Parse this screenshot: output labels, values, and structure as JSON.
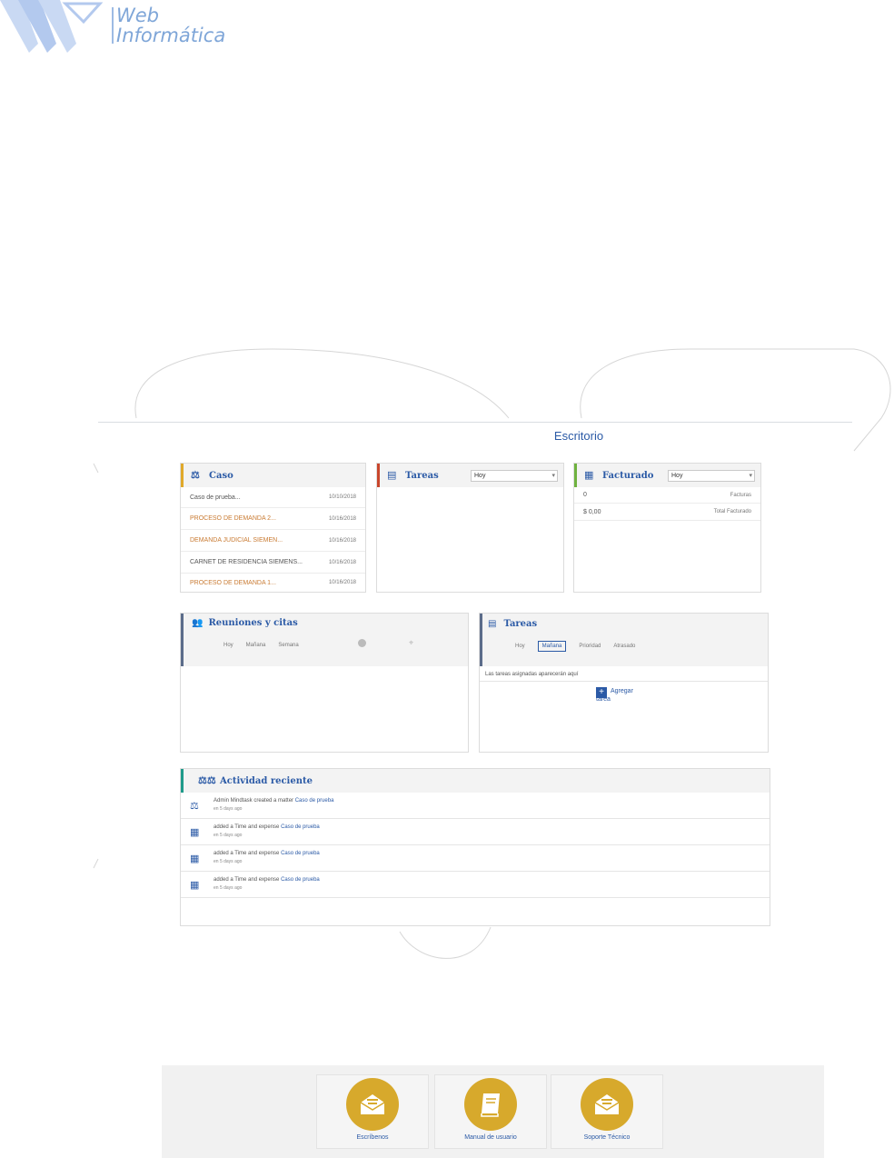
{
  "brand": {
    "line1": "Web",
    "line2": "Informática"
  },
  "page": {
    "title": "Escritorio"
  },
  "caso": {
    "title": "Caso",
    "rows": [
      {
        "name": "Caso de prueba...",
        "date": "10/10/2018"
      },
      {
        "name": "PROCESO DE DEMANDA 2...",
        "date": "10/16/2018"
      },
      {
        "name": "DEMANDA JUDICIAL SIEMEN...",
        "date": "10/16/2018"
      },
      {
        "name": "CARNET DE RESIDENCIA SIEMENS...",
        "date": "10/16/2018"
      },
      {
        "name": "PROCESO DE DEMANDA 1...",
        "date": "10/16/2018"
      }
    ]
  },
  "tareas_top": {
    "title": "Tareas",
    "select": "Hoy"
  },
  "facturado": {
    "title": "Facturado",
    "select": "Hoy",
    "rows": [
      {
        "value": "0",
        "label": "Facturas"
      },
      {
        "value": "$ 0,00",
        "label": "Total Facturado"
      }
    ]
  },
  "reuniones": {
    "title": "Reuniones y citas",
    "tabs": [
      "Hoy",
      "Mañana",
      "Semana"
    ]
  },
  "tareas": {
    "title": "Tareas",
    "tabs": [
      "Hoy",
      "Mañana",
      "Prioridad",
      "Atrasado"
    ],
    "empty": "Las tareas asignadas aparecerán aquí",
    "add_label": "Agregar",
    "add_sub": "tarea"
  },
  "actividad": {
    "title": "Actividad reciente",
    "items": [
      {
        "icon": "scales-icon",
        "text": "Admin Mindtask created a matter",
        "link": "Caso de prueba",
        "ago": "en 5 days ago"
      },
      {
        "icon": "calendar-icon",
        "text": "added a Time and expense",
        "link": "Caso de prueba",
        "ago": "en 5 days ago"
      },
      {
        "icon": "calendar-icon",
        "text": "added a Time and expense",
        "link": "Caso de prueba",
        "ago": "en 5 days ago"
      },
      {
        "icon": "calendar-icon",
        "text": "added a Time and expense",
        "link": "Caso de prueba",
        "ago": "en 5 days ago"
      }
    ]
  },
  "footer": {
    "items": [
      {
        "label": "Escríbenos",
        "icon": "envelope-icon"
      },
      {
        "label": "Manual de usuario",
        "icon": "book-icon"
      },
      {
        "label": "Soporte Técnico",
        "icon": "envelope-icon"
      }
    ]
  },
  "colors": {
    "accent": "#2b5aa6",
    "caso_bar": "#e0a92b",
    "tareas_bar": "#c9462c",
    "facturado_bar": "#6fb23f",
    "reuniones_bar": "#5b6c8a",
    "actividad_bar": "#1f9a8a",
    "footer_circle": "#d7a92c"
  }
}
